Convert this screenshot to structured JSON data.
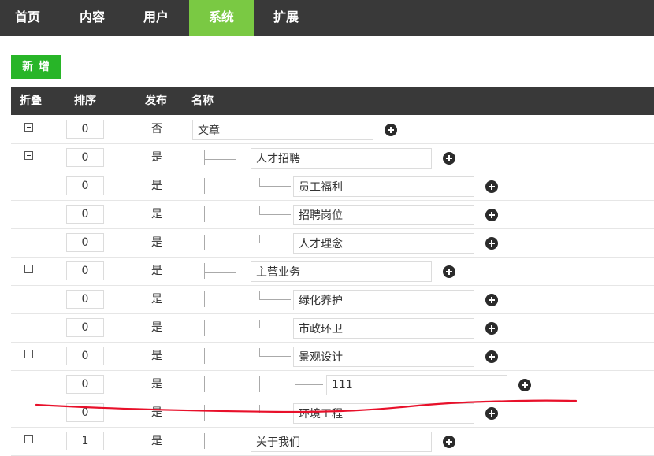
{
  "nav": {
    "items": [
      {
        "label": "首页",
        "active": false
      },
      {
        "label": "内容",
        "active": false
      },
      {
        "label": "用户",
        "active": false
      },
      {
        "label": "系统",
        "active": true
      },
      {
        "label": "扩展",
        "active": false
      }
    ]
  },
  "toolbar": {
    "add_label": "新 增"
  },
  "table": {
    "headers": {
      "fold": "折叠",
      "sort": "排序",
      "publish": "发布",
      "name": "名称"
    },
    "rows": [
      {
        "sort": "0",
        "publish": "否",
        "name": "文章",
        "level": 0,
        "foldable": true
      },
      {
        "sort": "0",
        "publish": "是",
        "name": "人才招聘",
        "level": 1,
        "foldable": true
      },
      {
        "sort": "0",
        "publish": "是",
        "name": "员工福利",
        "level": 2,
        "foldable": false
      },
      {
        "sort": "0",
        "publish": "是",
        "name": "招聘岗位",
        "level": 2,
        "foldable": false
      },
      {
        "sort": "0",
        "publish": "是",
        "name": "人才理念",
        "level": 2,
        "foldable": false
      },
      {
        "sort": "0",
        "publish": "是",
        "name": "主营业务",
        "level": 1,
        "foldable": true
      },
      {
        "sort": "0",
        "publish": "是",
        "name": "绿化养护",
        "level": 2,
        "foldable": false
      },
      {
        "sort": "0",
        "publish": "是",
        "name": "市政环卫",
        "level": 2,
        "foldable": false
      },
      {
        "sort": "0",
        "publish": "是",
        "name": "景观设计",
        "level": 2,
        "foldable": true
      },
      {
        "sort": "0",
        "publish": "是",
        "name": "111",
        "level": 3,
        "foldable": false
      },
      {
        "sort": "0",
        "publish": "是",
        "name": "环境工程",
        "level": 2,
        "foldable": false
      },
      {
        "sort": "1",
        "publish": "是",
        "name": "关于我们",
        "level": 1,
        "foldable": true
      }
    ]
  },
  "colors": {
    "nav_bg": "#393939",
    "nav_active": "#7ac943",
    "add_button": "#28b528",
    "annotation_stroke": "#e8102a"
  },
  "icons": [
    "collapse-icon",
    "plus-circle-icon"
  ]
}
